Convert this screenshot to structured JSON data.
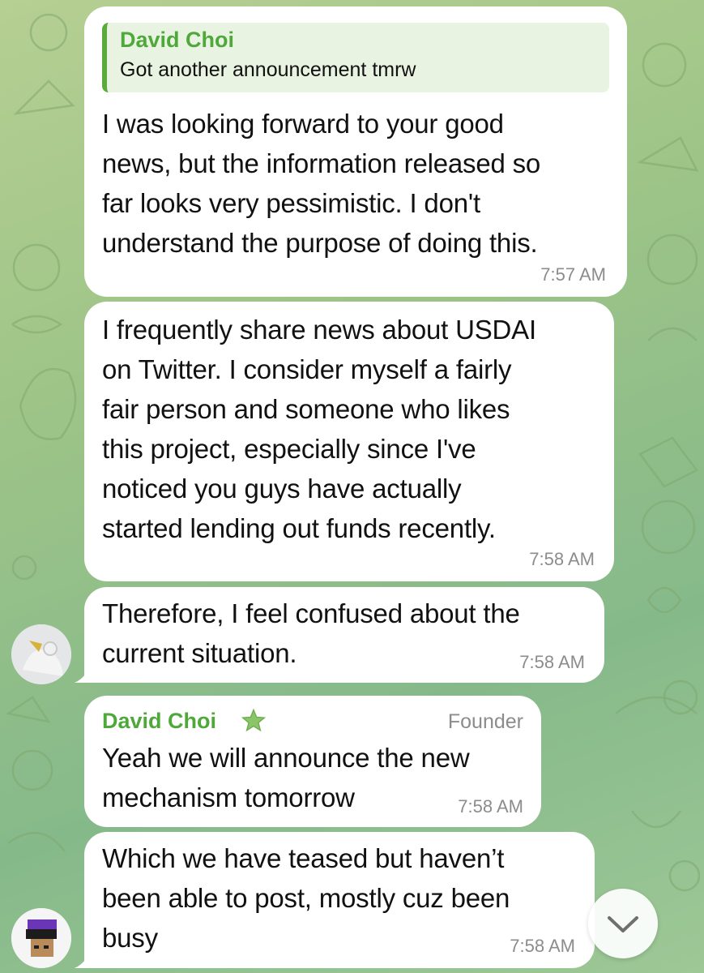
{
  "messages": [
    {
      "reply_to": {
        "name": "David Choi",
        "text": "Got another announcement tmrw"
      },
      "lines": [
        "I was looking forward to your good",
        "news, but the information released so",
        "far looks very pessimistic. I don't",
        "understand the purpose of doing this."
      ],
      "time": "7:57 AM"
    },
    {
      "lines": [
        "I frequently share news about USDAI",
        "on Twitter. I consider myself a fairly",
        "fair person and someone who likes",
        "this project, especially since I've",
        "noticed you guys have actually",
        "started lending out funds recently."
      ],
      "time": "7:58 AM"
    },
    {
      "lines": [
        "Therefore, I feel confused about the",
        "current situation."
      ],
      "time": "7:58 AM"
    },
    {
      "sender": "David Choi",
      "role": "Founder",
      "lines": [
        "Yeah we will announce the new",
        "mechanism tomorrow"
      ],
      "time": "7:58 AM"
    },
    {
      "lines": [
        "Which we have teased but haven’t",
        "been able to post, mostly cuz been",
        "busy"
      ],
      "time": "7:58 AM"
    }
  ],
  "icons": {
    "star": "star-icon",
    "scroll_down": "chevron-down-icon"
  },
  "colors": {
    "sender_name": "#4ea83a",
    "quote_bar": "#5aaa3c",
    "quote_bg": "#e9f3e2",
    "timestamp": "#8c8c8c",
    "chat_background": "#9dc488"
  }
}
